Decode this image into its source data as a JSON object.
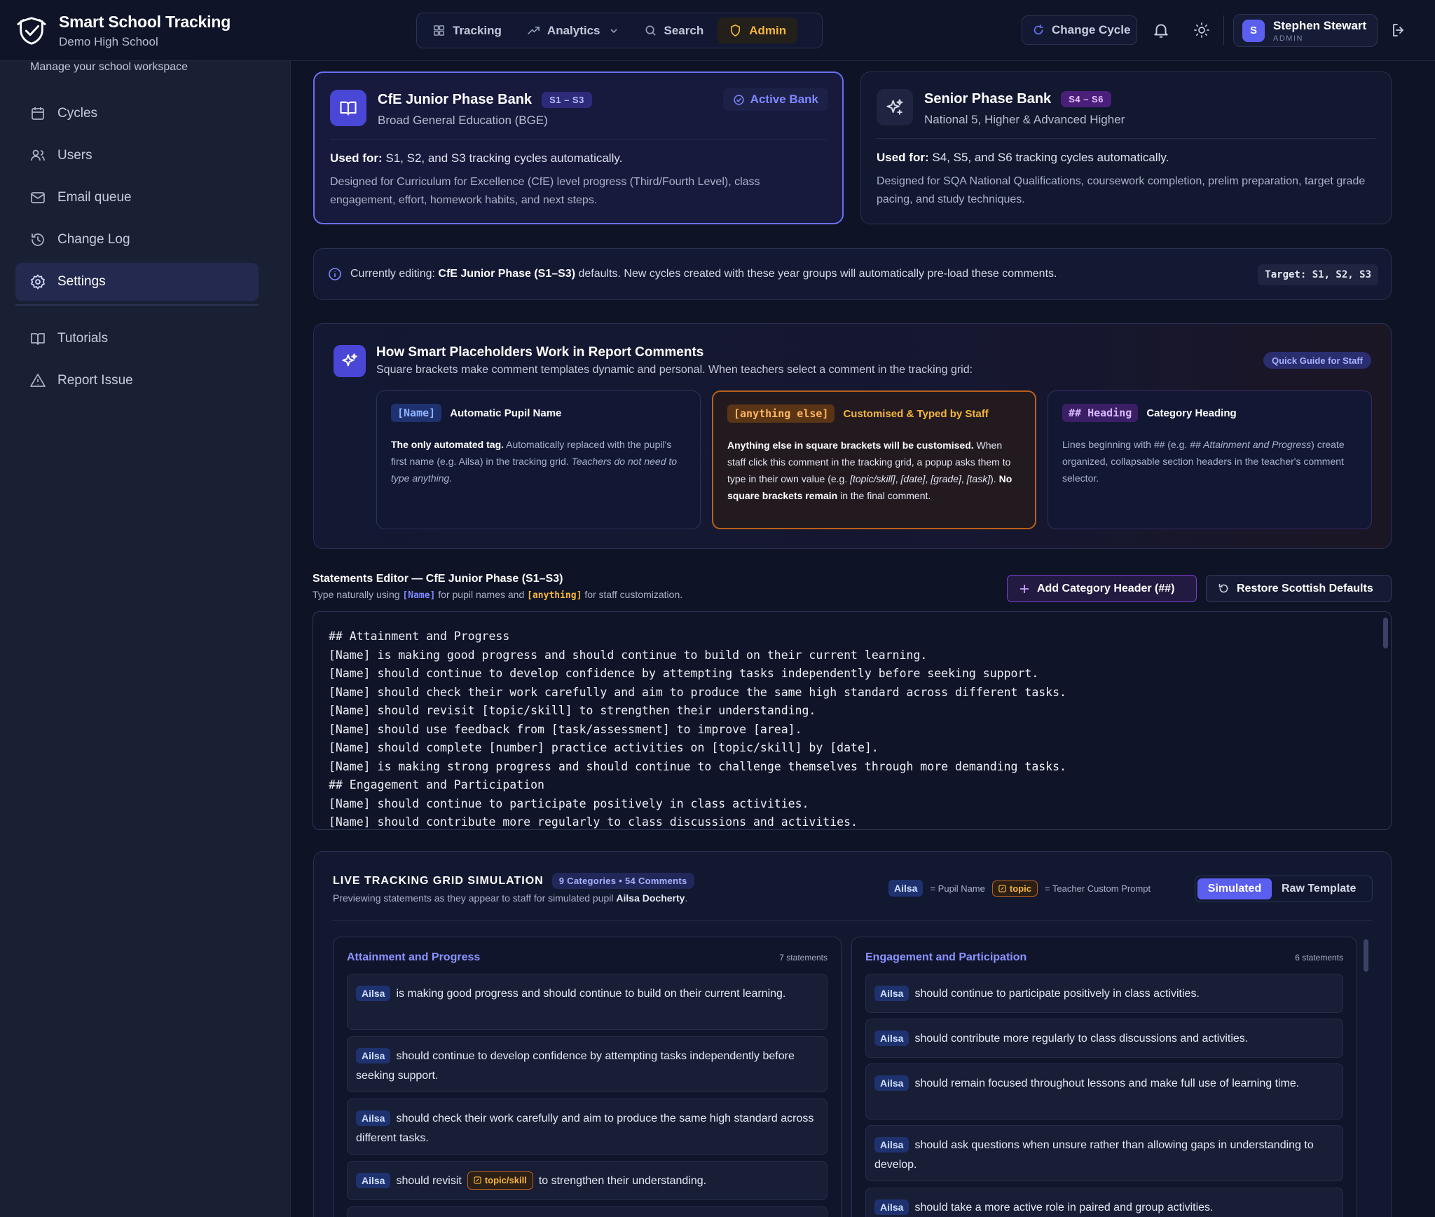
{
  "app": {
    "title": "Smart School Tracking",
    "school": "Demo High School"
  },
  "nav": {
    "tracking": "Tracking",
    "analytics": "Analytics",
    "search": "Search",
    "admin": "Admin"
  },
  "header": {
    "change_cycle": "Change Cycle",
    "user_name": "Stephen Stewart",
    "user_role": "ADMIN",
    "user_initial": "S"
  },
  "sidebar": {
    "workspace_text": "Manage your school workspace",
    "items": [
      {
        "label": "Cycles",
        "icon": "calendar-icon"
      },
      {
        "label": "Users",
        "icon": "users-icon"
      },
      {
        "label": "Email queue",
        "icon": "mail-icon"
      },
      {
        "label": "Change Log",
        "icon": "history-icon"
      },
      {
        "label": "Settings",
        "icon": "gear-icon"
      },
      {
        "label": "Tutorials",
        "icon": "book-icon"
      },
      {
        "label": "Report Issue",
        "icon": "warning-icon"
      }
    ],
    "active": "Settings"
  },
  "banks": {
    "junior": {
      "title": "CfE Junior Phase Bank",
      "range": "S1 – S3",
      "subtitle": "Broad General Education (BGE)",
      "badge": "Active Bank",
      "used_label": "Used for:",
      "used_text": "S1, S2, and S3 tracking cycles automatically.",
      "description": "Designed for Curriculum for Excellence (CfE) level progress (Third/Fourth Level), class engagement, effort, homework habits, and next steps."
    },
    "senior": {
      "title": "Senior Phase Bank",
      "range": "S4 – S6",
      "subtitle": "National 5, Higher & Advanced Higher",
      "used_label": "Used for:",
      "used_text": "S4, S5, and S6 tracking cycles automatically.",
      "description": "Designed for SQA National Qualifications, coursework completion, prelim preparation, target grade pacing, and study techniques."
    }
  },
  "editing": {
    "prefix": "Currently editing:",
    "phase": "CfE Junior Phase (S1–S3)",
    "suffix": "defaults. New cycles created with these year groups will automatically pre-load these comments.",
    "target": "Target: S1, S2, S3"
  },
  "guide": {
    "title": "How Smart Placeholders Work in Report Comments",
    "subtitle": "Square brackets make comment templates dynamic and personal. When teachers select a comment in the tracking grid:",
    "quick": "Quick Guide for Staff",
    "cards": [
      {
        "tag": "[Name]",
        "label": "Automatic Pupil Name",
        "b1": "The only automated tag.",
        "t1": " Automatically replaced with the pupil's first name (e.g. Ailsa) in the tracking grid. ",
        "i1": "Teachers do not need to type anything."
      },
      {
        "tag": "[anything else]",
        "label": "Customised & Typed by Staff",
        "b1": "Anything else in square brackets will be customised.",
        "t1": " When staff click this comment in the tracking grid, a popup asks them to type in their own value (e.g. ",
        "i1": "[topic/skill]",
        "t2": ", ",
        "i2": "[date]",
        "t3": ", ",
        "i3": "[grade]",
        "t4": ", ",
        "i4": "[task]",
        "t5": "). ",
        "b2": "No square brackets remain",
        "t6": " in the final comment."
      },
      {
        "tag": "## Heading",
        "label": "Category Heading",
        "t1": "Lines beginning with ",
        "i1": "##",
        "t2": " (e.g. ",
        "i2": "## Attainment and Progress",
        "t3": ") create organized, collapsable section headers in the teacher's comment selector."
      }
    ]
  },
  "editor": {
    "title": "Statements Editor — CfE Junior Phase (S1–S3)",
    "sub_pre": "Type naturally using",
    "sub_name": "[Name]",
    "sub_mid": "for pupil names and",
    "sub_any": "[anything]",
    "sub_post": "for staff customization.",
    "add_button": "Add Category Header (##)",
    "restore_button": "Restore Scottish Defaults",
    "lines": [
      "## Attainment and Progress",
      "[Name] is making good progress and should continue to build on their current learning.",
      "[Name] should continue to develop confidence by attempting tasks independently before seeking support.",
      "[Name] should check their work carefully and aim to produce the same high standard across different tasks.",
      "[Name] should revisit [topic/skill] to strengthen their understanding.",
      "[Name] should use feedback from [task/assessment] to improve [area].",
      "[Name] should complete [number] practice activities on [topic/skill] by [date].",
      "[Name] is making strong progress and should continue to challenge themselves through more demanding tasks.",
      "## Engagement and Participation",
      "[Name] should continue to participate positively in class activities.",
      "[Name] should contribute more regularly to class discussions and activities."
    ]
  },
  "simulation": {
    "title": "LIVE TRACKING GRID SIMULATION",
    "counts": "9 Categories • 54 Comments",
    "sub_pre": "Previewing statements as they appear to staff for simulated pupil",
    "pupil_full": "Ailsa Docherty",
    "sub_post": ".",
    "legend_name": "Ailsa",
    "legend_name_text": "= Pupil Name",
    "legend_topic": "topic",
    "legend_topic_text": "= Teacher Custom Prompt",
    "toggle_on": "Simulated",
    "toggle_off": "Raw Template",
    "pupil": "Ailsa",
    "columns": [
      {
        "heading": "Attainment and Progress",
        "count": "7 statements",
        "statements": [
          {
            "text": "is making good progress and should continue to build on their current learning."
          },
          {
            "text": "should continue to develop confidence by attempting tasks independently before seeking support."
          },
          {
            "text": "should check their work carefully and aim to produce the same high standard across different tasks."
          },
          {
            "pre": "should revisit",
            "topic": "topic/skill",
            "post": "to strengthen their understanding."
          }
        ]
      },
      {
        "heading": "Engagement and Participation",
        "count": "6 statements",
        "statements": [
          {
            "text": "should continue to participate positively in class activities."
          },
          {
            "text": "should contribute more regularly to class discussions and activities."
          },
          {
            "text": "should remain focused throughout lessons and make full use of learning time."
          },
          {
            "text": "should ask questions when unsure rather than allowing gaps in understanding to develop."
          },
          {
            "text": "should take a more active role in paired and group activities."
          }
        ]
      }
    ]
  },
  "colors": {
    "accent": "#5b5ff0",
    "admin": "#f7b63b",
    "custom": "#f7b63b"
  }
}
